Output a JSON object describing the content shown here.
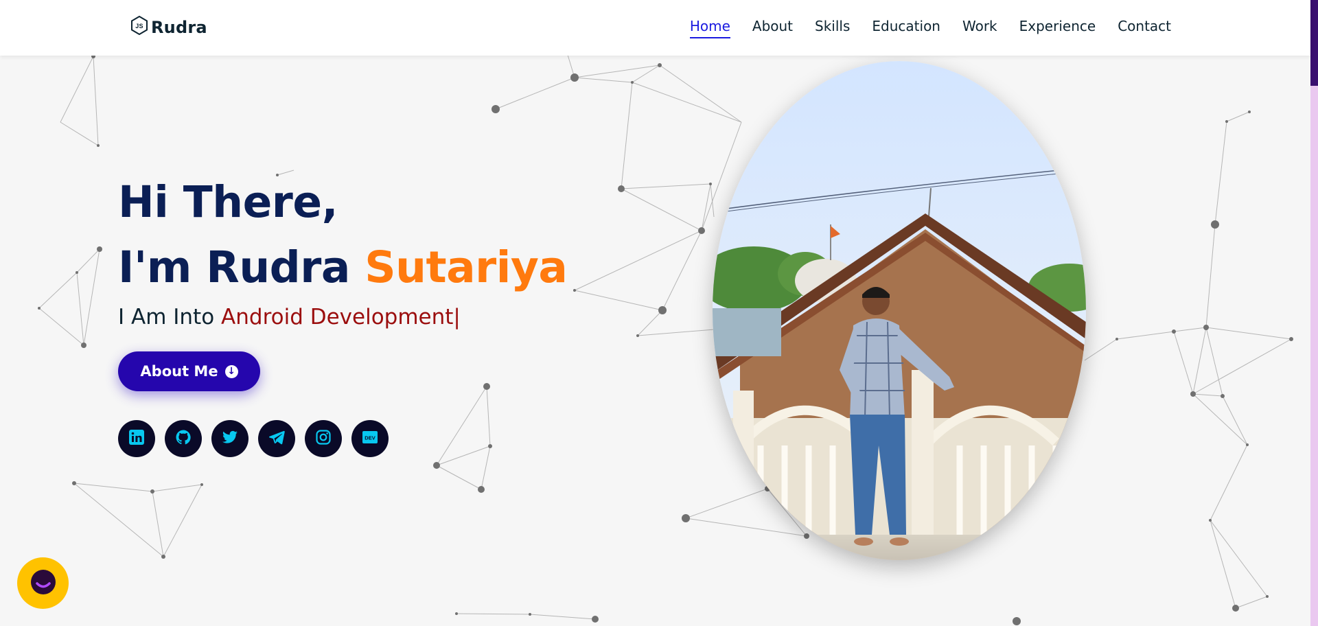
{
  "header": {
    "logo_text": "Rudra",
    "logo_icon": "nodejs-hexagon-icon",
    "nav": [
      "Home",
      "About",
      "Skills",
      "Education",
      "Work",
      "Experience",
      "Contact"
    ],
    "active_nav": "Home"
  },
  "hero": {
    "greeting": "Hi There,",
    "im": "I'm Rudra",
    "surname": "Sutariya",
    "typed_prefix": "I Am Into",
    "typed_role": "Android Development|",
    "about_button": "About Me",
    "about_button_icon": "arrow-down-circle-icon"
  },
  "socials": [
    {
      "name": "linkedin-icon"
    },
    {
      "name": "github-icon"
    },
    {
      "name": "twitter-icon"
    },
    {
      "name": "telegram-icon"
    },
    {
      "name": "instagram-icon"
    },
    {
      "name": "dev-icon",
      "label": "DEV"
    }
  ],
  "colors": {
    "header_bg": "#ffffff",
    "page_bg": "#f6f6f6",
    "heading": "#0b1f55",
    "accent": "#ff7a0e",
    "role": "#9b0e0e",
    "button": "#2506ad",
    "active_nav": "#1a1ae0",
    "social_bg": "#0a0a28",
    "social_icon": "#08c8f0",
    "chat_widget": "#ffc200",
    "scroll_thumb": "#3a1070",
    "scroll_track": "#eac8f0"
  },
  "chat_widget": {
    "icon": "chat-bubble-icon"
  }
}
